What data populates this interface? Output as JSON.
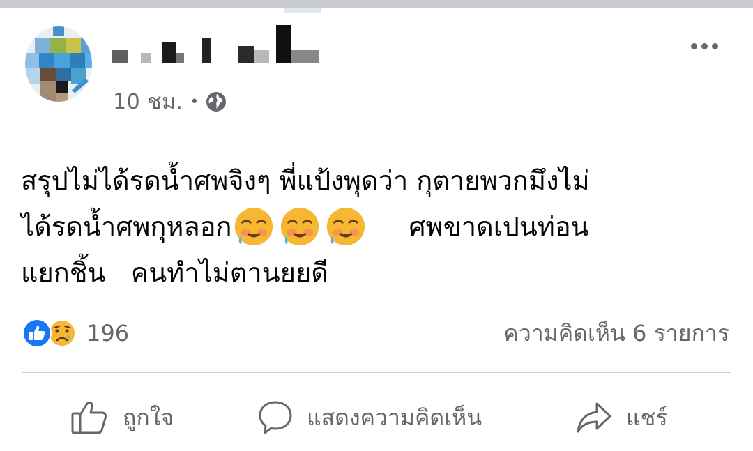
{
  "post": {
    "author_name": "",
    "time": "10 ชม.",
    "separator": "•",
    "privacy_icon": "globe-icon",
    "more_icon": "more-dots-icon",
    "text_lines": [
      {
        "text": "สรุปไม่ได้รดน้ำศพจิงๆ พี่แป้งพุดว่า กุตายพวกมึงไม่"
      },
      {
        "text_before": "ได้รดน้ำศพกุหลอก",
        "emoji": [
          "crying-face-emoji",
          "crying-face-emoji",
          "crying-face-emoji"
        ],
        "text_after": "ศพขาดเปนท่อน"
      },
      {
        "text": "แยกชิ้น   คนทำไม่ตานยยดี"
      }
    ]
  },
  "stats": {
    "reaction_icons": [
      "like-reaction-icon",
      "sad-reaction-icon"
    ],
    "reaction_count": "196",
    "comments_label": "ความคิดเห็น 6 รายการ"
  },
  "actions": {
    "like_label": "ถูกใจ",
    "comment_label": "แสดงความคิดเห็น",
    "share_label": "แชร์"
  },
  "colors": {
    "text": "#050505",
    "secondary": "#65676b",
    "like_blue": "#1877f2",
    "divider": "#ced0d4"
  }
}
